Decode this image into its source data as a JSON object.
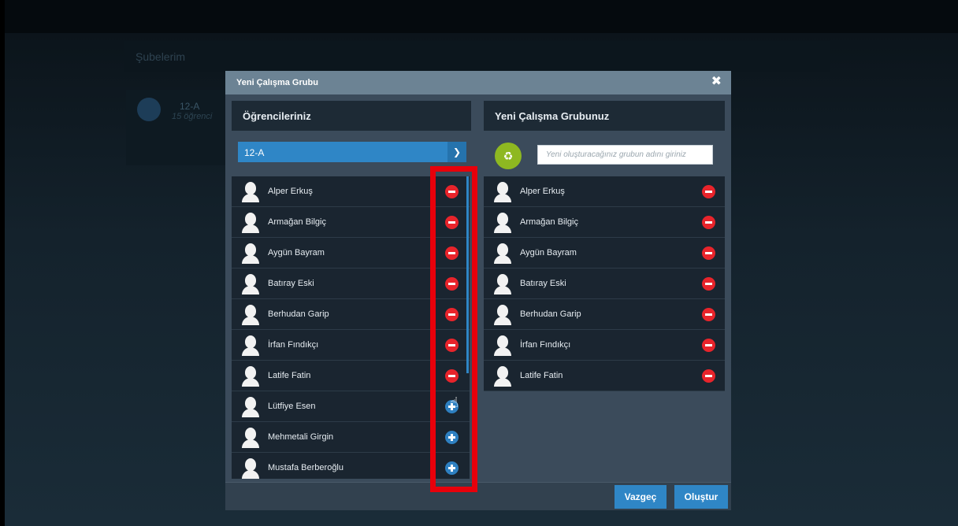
{
  "background": {
    "section_title": "Şubelerim",
    "card": {
      "name": "12-A",
      "count": "15 öğrenci"
    }
  },
  "modal": {
    "title": "Yeni Çalışma Grubu",
    "close_icon": "close-icon",
    "left_panel": {
      "title": "Öğrencileriniz",
      "class_select": {
        "value": "12-A",
        "icon": "chevron-down-icon"
      },
      "students": [
        {
          "name": "Alper Erkuş",
          "action": "remove"
        },
        {
          "name": "Armağan Bilgiç",
          "action": "remove"
        },
        {
          "name": "Aygün Bayram",
          "action": "remove"
        },
        {
          "name": "Batıray Eski",
          "action": "remove"
        },
        {
          "name": "Berhudan Garip",
          "action": "remove"
        },
        {
          "name": "İrfan Fındıkçı",
          "action": "remove"
        },
        {
          "name": "Latife Fatin",
          "action": "remove"
        },
        {
          "name": "Lütfiye Esen",
          "action": "add"
        },
        {
          "name": "Mehmetali Girgin",
          "action": "add"
        },
        {
          "name": "Mustafa Berberoğlu",
          "action": "add"
        }
      ]
    },
    "right_panel": {
      "title": "Yeni Çalışma Grubunuz",
      "group_icon": "group-icon",
      "group_name_placeholder": "Yeni oluşturacağınız grubun adını giriniz",
      "members": [
        {
          "name": "Alper Erkuş"
        },
        {
          "name": "Armağan Bilgiç"
        },
        {
          "name": "Aygün Bayram"
        },
        {
          "name": "Batıray Eski"
        },
        {
          "name": "Berhudan Garip"
        },
        {
          "name": "İrfan Fındıkçı"
        },
        {
          "name": "Latife Fatin"
        }
      ]
    },
    "footer": {
      "cancel_label": "Vazgeç",
      "create_label": "Oluştur"
    }
  },
  "colors": {
    "accent": "#2f86c6",
    "remove": "#e8242b",
    "group_icon": "#8eb821",
    "highlight": "#e8000b"
  }
}
